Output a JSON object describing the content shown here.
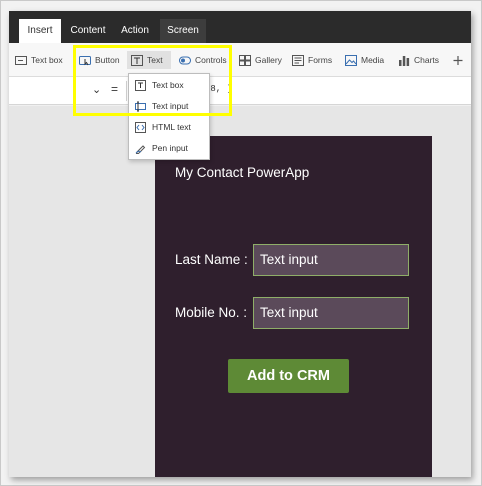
{
  "tabs": [
    {
      "label": "Insert",
      "active": true
    },
    {
      "label": "Content",
      "active": false
    },
    {
      "label": "Action",
      "active": false
    },
    {
      "label": "Screen",
      "active": false
    }
  ],
  "ribbon": {
    "textbox": "Text box",
    "button": "Button",
    "text": "Text",
    "controls": "Controls",
    "gallery": "Gallery",
    "forms": "Forms",
    "media": "Media",
    "charts": "Charts"
  },
  "formula": {
    "expression": "48, )"
  },
  "dropdown": {
    "items": [
      "Text box",
      "Text input",
      "HTML text",
      "Pen input"
    ]
  },
  "app": {
    "title": "My Contact PowerApp",
    "last_name_label": "Last Name :",
    "last_name_value": "Text input",
    "mobile_label": "Mobile No. :",
    "mobile_value": "Text input",
    "add_button": "Add to CRM"
  },
  "colors": {
    "highlight": "#ffff00",
    "app_background": "#2f1f2d",
    "button_green": "#5e8a36",
    "input_border": "#8fae68"
  }
}
